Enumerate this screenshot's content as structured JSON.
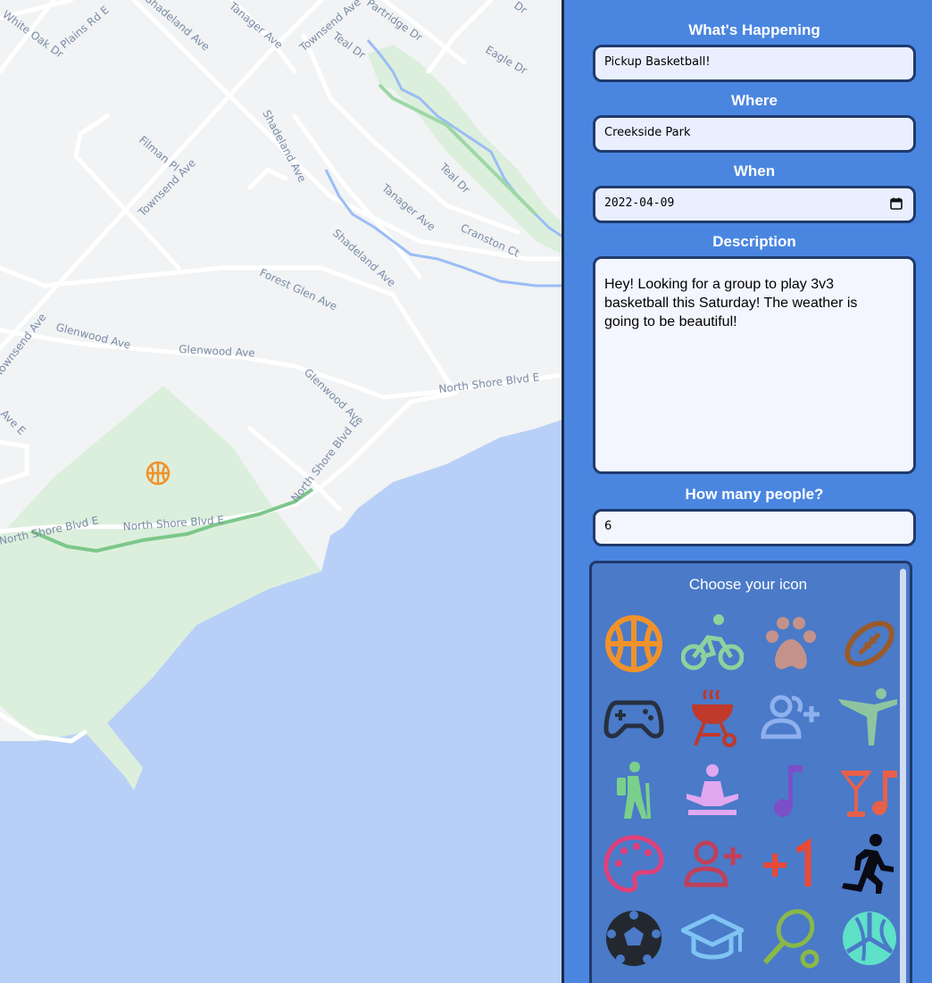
{
  "map": {
    "streets": {
      "white_oak": "White Oak Dr",
      "plains": "Plains Rd E",
      "shadeland_top": "Shadeland Ave",
      "tanager_top": "Tanager Ave",
      "townsend_top": "Townsend Ave",
      "partridge": "Partridge Dr",
      "teal_top": "Teal Dr",
      "eagle": "Eagle Dr",
      "filman": "Filman Pl",
      "townsend_mid": "Townsend Ave",
      "shadeland_mid": "Shadeland Ave",
      "teal_mid": "Teal Dr",
      "tanager_mid": "Tanager Ave",
      "cranston": "Cranston Ct",
      "shadeland_low": "Shadeland Ave",
      "forest_glen": "Forest Glen Ave",
      "townsend_left": "Townsend Ave",
      "glenwood_1": "Glenwood Ave",
      "glenwood_2": "Glenwood Ave",
      "glenwood_3": "Glenwood Ave",
      "north_shore_right": "North Shore Blvd E",
      "north_shore_diag": "North Shore Blvd E",
      "north_shore_mid": "North Shore Blvd E",
      "north_shore_left": "North Shore Blvd E",
      "ave_e": "Ave E",
      "dr_top": "Dr"
    },
    "marker_icon": "basketball-icon",
    "colors": {
      "land": "#f1f3f4",
      "park": "#dcefdc",
      "water": "#b8d0f7",
      "road": "#ffffff",
      "trail": "#7cc78a",
      "creek": "#9bbdf6"
    }
  },
  "form": {
    "what_label": "What's Happening",
    "what_value": "Pickup Basketball!",
    "where_label": "Where",
    "where_value": "Creekside Park",
    "when_label": "When",
    "when_value": "2022-04-09",
    "description_label": "Description",
    "description_value": "Hey! Looking for a group to play 3v3 basketball this Saturday! The weather is going to be beautiful!",
    "people_label": "How many people?",
    "people_value": "6"
  },
  "icon_picker": {
    "title": "Choose your icon",
    "icons": [
      "basketball-icon",
      "bicycle-icon",
      "paw-icon",
      "football-icon",
      "gamepad-icon",
      "grill-icon",
      "group-add-icon",
      "martial-arts-icon",
      "hiking-icon",
      "meditation-icon",
      "music-note-icon",
      "cocktail-music-icon",
      "palette-icon",
      "person-add-icon",
      "plus-one-icon",
      "running-icon",
      "soccer-ball-icon",
      "graduation-cap-icon",
      "tennis-icon",
      "volleyball-icon"
    ],
    "colors": {
      "basketball": "#f0922b",
      "bicycle": "#8fd19e",
      "paw": "#c4928a",
      "football": "#9a5a2a",
      "gamepad": "#263040",
      "grill": "#c0392b",
      "group_add": "#8fb0ee",
      "martial_arts": "#8ec5a0",
      "hiking": "#7ad08a",
      "meditation": "#e0a8f0",
      "music": "#7b4fc8",
      "cocktail": "#e8604a",
      "palette": "#e0407a",
      "person_add": "#c0405a",
      "plus_one": "#e84a3a",
      "running": "#0a0a14",
      "soccer": "#232830",
      "cap": "#7fc4f4",
      "tennis": "#8ab848",
      "volleyball": "#5fe0c8"
    }
  }
}
